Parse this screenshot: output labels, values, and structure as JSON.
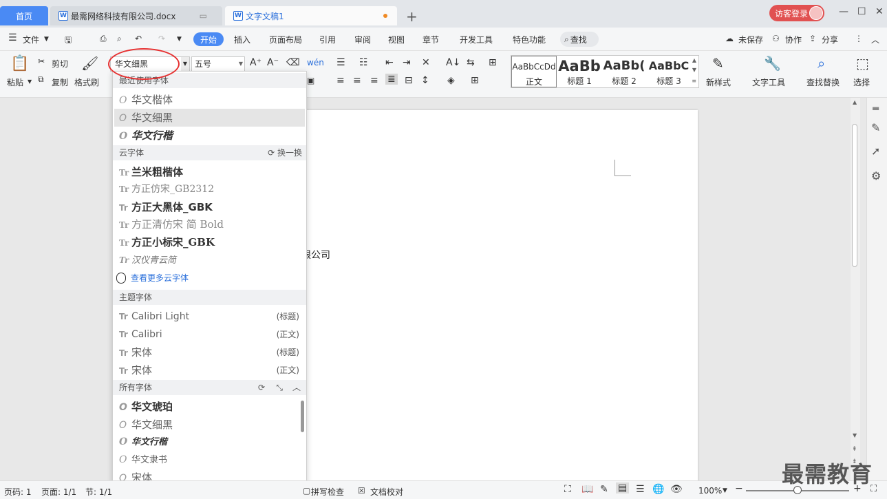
{
  "tabs": {
    "home": "首页",
    "doc1": "最需网络科技有限公司.docx",
    "doc2": "文字文稿1",
    "login": "访客登录"
  },
  "menu": {
    "file": "文件",
    "start": "开始",
    "insert": "插入",
    "layout": "页面布局",
    "reference": "引用",
    "review": "审阅",
    "view": "视图",
    "chapter": "章节",
    "devtools": "开发工具",
    "special": "特色功能",
    "search": "查找",
    "unsaved": "未保存",
    "collab": "协作",
    "share": "分享"
  },
  "ribbon": {
    "paste": "粘贴",
    "cut": "剪切",
    "copy": "复制",
    "format_painter": "格式刷",
    "font_value": "华文细黑",
    "size_value": "五号",
    "styles": [
      {
        "preview": "AaBbCcDd",
        "label": "正文"
      },
      {
        "preview": "AaBb",
        "label": "标题 1"
      },
      {
        "preview": "AaBb(",
        "label": "标题 2"
      },
      {
        "preview": "AaBbC",
        "label": "标题 3"
      }
    ],
    "new_style": "新样式",
    "text_tools": "文字工具",
    "find_replace": "查找替换",
    "select": "选择"
  },
  "dropdown": {
    "recent_header": "最近使用字体",
    "recent": [
      "华文楷体",
      "华文细黑",
      "华文行楷"
    ],
    "cloud_header": "云字体",
    "cloud_refresh": "换一换",
    "cloud": [
      "兰米粗楷体",
      "方正仿宋_GB2312",
      "方正大黑体_GBK",
      "方正清仿宋 简 Bold",
      "方正小标宋_GBK",
      "汉仪青云简"
    ],
    "more_cloud": "查看更多云字体",
    "theme_header": "主题字体",
    "theme": [
      {
        "name": "Calibri Light",
        "tag": "(标题)"
      },
      {
        "name": "Calibri",
        "tag": "(正文)"
      },
      {
        "name": "宋体",
        "tag": "(标题)"
      },
      {
        "name": "宋体",
        "tag": "(正文)"
      }
    ],
    "all_header": "所有字体",
    "all": [
      "华文琥珀",
      "华文细黑",
      "华文行楷",
      "华文隶书",
      "宋体"
    ]
  },
  "document": {
    "body_text": "限公司"
  },
  "status": {
    "page_code": "页码: 1",
    "page": "页面: 1/1",
    "section": "节: 1/1",
    "spell": "拼写检查",
    "proof": "文档校对",
    "zoom": "100%"
  },
  "watermark": "最需教育"
}
